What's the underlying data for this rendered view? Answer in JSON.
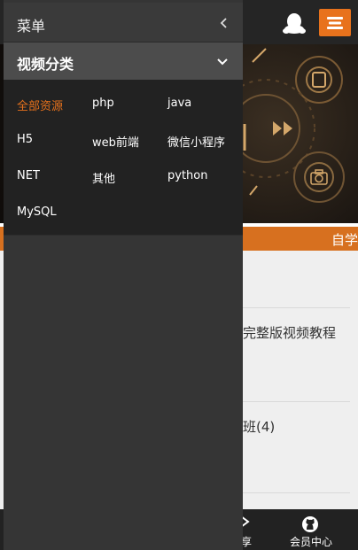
{
  "drawer": {
    "title": "菜单",
    "close_icon": "chevron-left-icon",
    "category_header": "视频分类",
    "category_toggle_icon": "chevron-down-icon",
    "categories": [
      {
        "label": "全部资源",
        "active": true
      },
      {
        "label": "php",
        "active": false
      },
      {
        "label": "java",
        "active": false
      },
      {
        "label": "H5",
        "active": false
      },
      {
        "label": "web前端",
        "active": false
      },
      {
        "label": "微信小程序",
        "active": false
      },
      {
        "label": "NET",
        "active": false
      },
      {
        "label": "其他",
        "active": false
      },
      {
        "label": "python",
        "active": false
      },
      {
        "label": "MySQL",
        "active": false
      }
    ]
  },
  "topbar": {
    "qq_icon": "qq-penguin-icon",
    "menu_icon": "menu-icon"
  },
  "banner": {
    "icon": "camera-icon"
  },
  "orangebar": {
    "text": "自学"
  },
  "content": {
    "item1": "完整版视频教程",
    "item2": "班(4)"
  },
  "bottombar": {
    "share_label": "享",
    "member_label": "会员中心",
    "member_icon": "github-icon"
  },
  "colors": {
    "accent": "#e8721c",
    "drawer_bg": "#353535",
    "grid_bg": "#222222"
  }
}
